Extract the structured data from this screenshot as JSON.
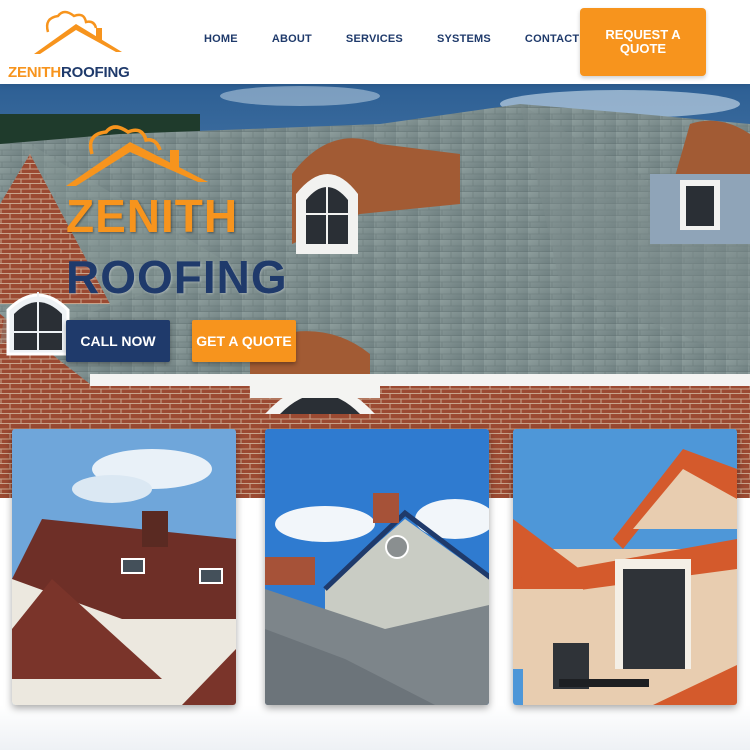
{
  "brand": {
    "name_part1": "ZENITH",
    "name_part2": "ROOFING"
  },
  "nav": {
    "items": [
      {
        "label": "HOME"
      },
      {
        "label": "ABOUT"
      },
      {
        "label": "SERVICES"
      },
      {
        "label": "SYSTEMS"
      },
      {
        "label": "CONTACT"
      }
    ]
  },
  "header": {
    "cta_label": "REQUEST A QUOTE"
  },
  "hero": {
    "title_line1": "ZENITH",
    "title_line2": "ROOFING",
    "call_label": "CALL NOW",
    "quote_label": "GET A QUOTE"
  },
  "colors": {
    "brand_orange": "#f7941d",
    "brand_navy": "#1f3a6b"
  }
}
